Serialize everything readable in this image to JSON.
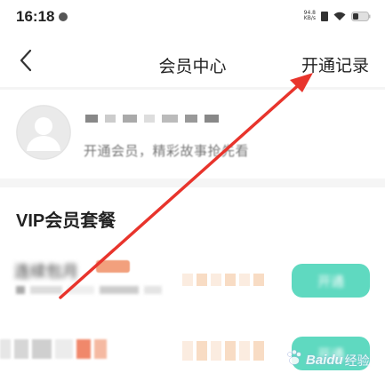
{
  "status_bar": {
    "time": "16:18",
    "net_speed_value": "94.8",
    "net_speed_unit": "KB/s"
  },
  "header": {
    "back_icon": "chevron-left-icon",
    "title": "会员中心",
    "records_label": "开通记录"
  },
  "profile": {
    "tagline": "开通会员，精彩故事抢先看"
  },
  "vip": {
    "section_title": "VIP会员套餐",
    "plans": [
      {
        "name": "连续包月",
        "button_label": "开通"
      },
      {
        "name": "",
        "button_label": "开通"
      }
    ]
  },
  "colors": {
    "accent_button": "#5fd9c0",
    "annotation_arrow": "#e8342c",
    "tag": "#f2a07d"
  },
  "watermark": {
    "brand": "Baidu",
    "suffix": "经验"
  }
}
